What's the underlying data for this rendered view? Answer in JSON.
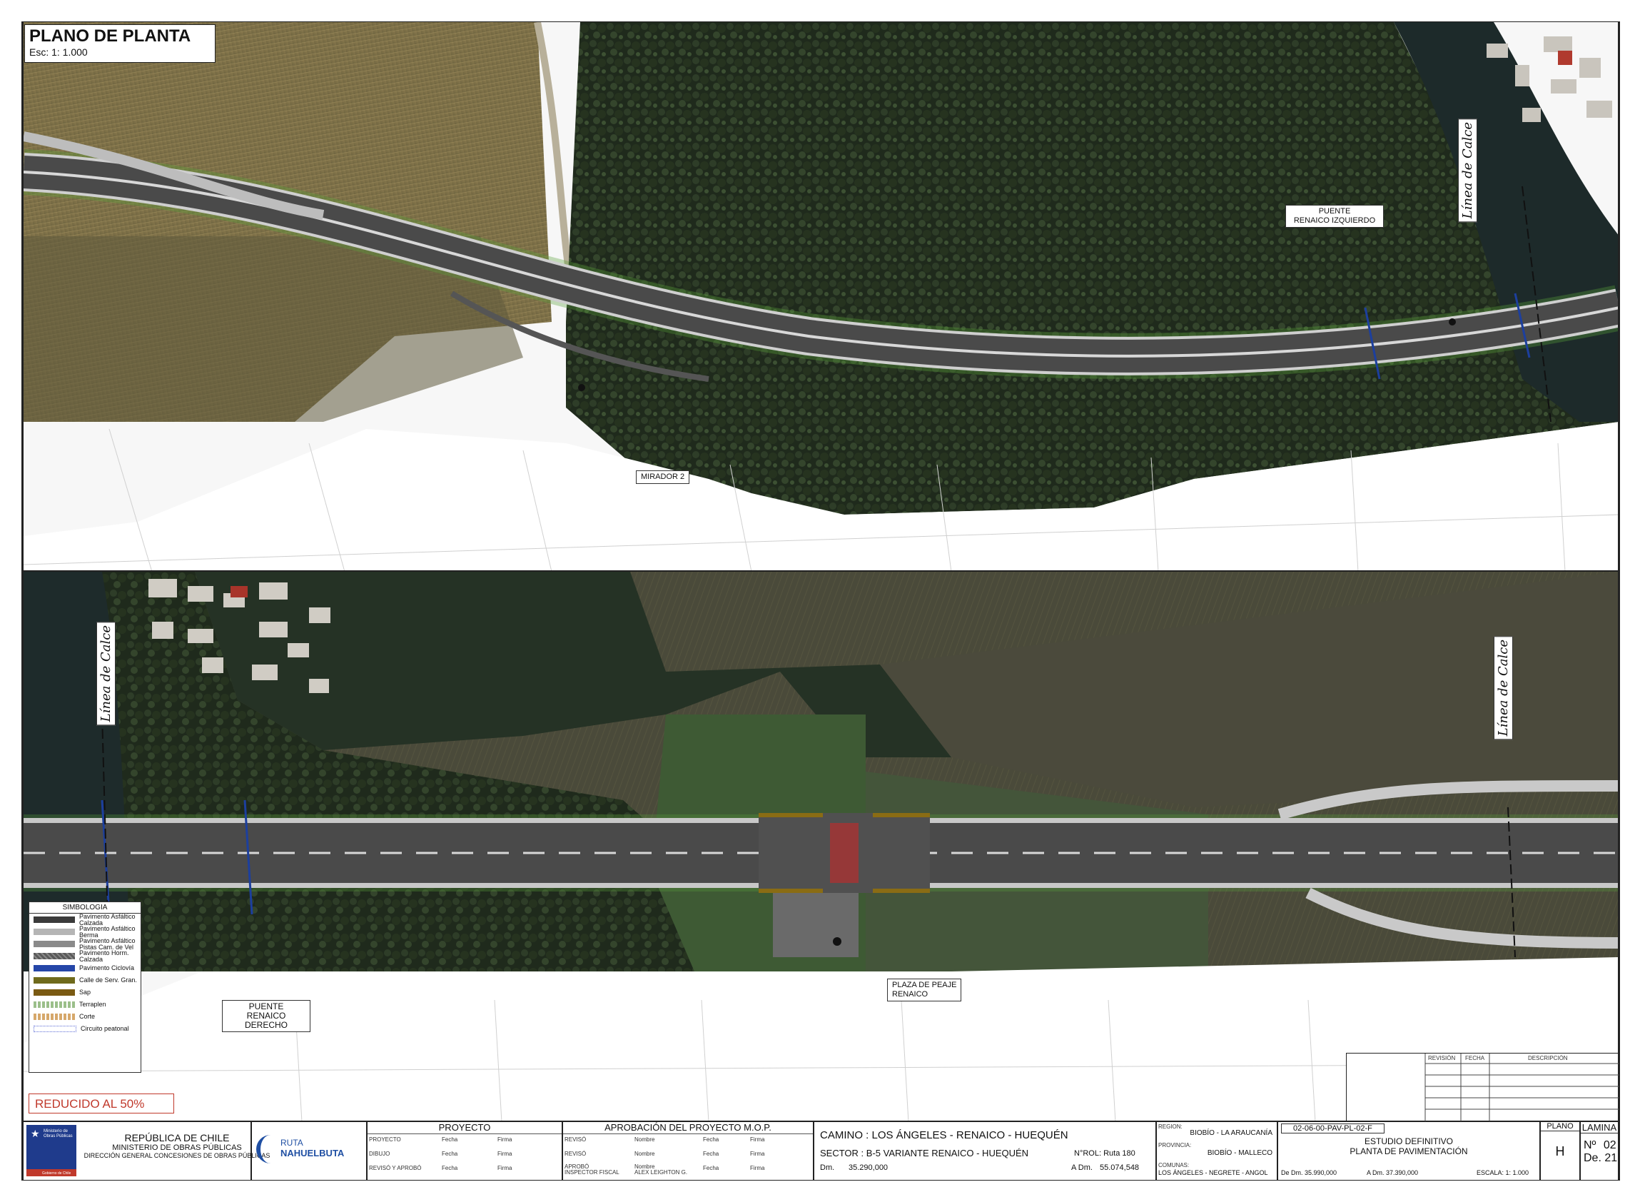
{
  "title": {
    "heading": "PLANO DE PLANTA",
    "scale": "Esc: 1: 1.000"
  },
  "labels": {
    "puente_izq": [
      "PUENTE",
      "RENAICO IZQUIERDO"
    ],
    "mirador": "MIRADOR 2",
    "puente_der": [
      "PUENTE",
      "RENAICO DERECHO"
    ],
    "plaza_peaje": [
      "PLAZA DE PEAJE",
      "RENAICO"
    ],
    "linea_calce": "Línea de Calce"
  },
  "legend": {
    "title": "SIMBOLOGIA",
    "items": [
      {
        "label": "Pavimento Asfáltico Calzada",
        "color": "#3b3b3b",
        "icon": "swatch-solid"
      },
      {
        "label": "Pavimento Asfáltico Berma",
        "color": "#b5b5b5",
        "icon": "swatch-solid"
      },
      {
        "label": "Pavimento Asfáltico Pistas Cam. de Vel",
        "color": "#8a8a8a",
        "icon": "swatch-solid"
      },
      {
        "label": "Pavimento Horm. Calzada",
        "color": "#5a5a5a",
        "icon": "swatch-hatched"
      },
      {
        "label": "Pavimento Ciclovía",
        "color": "#2546a8",
        "icon": "swatch-solid"
      },
      {
        "label": "Calle de Serv. Gran.",
        "color": "#6f6a1c",
        "icon": "swatch-solid"
      },
      {
        "label": "Sap",
        "color": "#7a5a12",
        "icon": "swatch-solid"
      },
      {
        "label": "Terraplen",
        "color": "#9bbf8a",
        "icon": "swatch-dashed"
      },
      {
        "label": "Corte",
        "color": "#d6a86b",
        "icon": "swatch-dashed"
      },
      {
        "label": "Circuito peatonal",
        "color": "#5b6bd6",
        "icon": "swatch-dotted"
      }
    ]
  },
  "reducido": "REDUCIDO AL 50%",
  "revision_table": {
    "headers": [
      "REVISIÓN",
      "FECHA",
      "DESCRIPCIÓN"
    ]
  },
  "titleblock": {
    "gov": [
      "REPÚBLICA DE CHILE",
      "MINISTERIO DE OBRAS PÚBLICAS",
      "DIRECCIÓN GENERAL CONCESIONES DE OBRAS PÚBLICAS"
    ],
    "ministry_logo_text": [
      "Ministerio de",
      "Obras Públicas"
    ],
    "gobierno": "Gobierno de Chile",
    "ruta_logo": [
      "RUTA",
      "NAHUELBUTA"
    ],
    "proyecto_title": "PROYECTO",
    "proyecto_rows": [
      "PROYECTO",
      "DIBUJO",
      "REVISÓ Y APROBÓ"
    ],
    "col_fecha": "Fecha",
    "col_firma": "Firma",
    "aprob_title": "APROBACIÓN DEL PROYECTO M.O.P.",
    "aprob_rows": [
      "REVISÓ",
      "REVISÓ",
      "APROBÓ"
    ],
    "aprob_sub": "INSPECTOR FISCAL",
    "col_nombre": "Nombre",
    "aprob_name": "ALEX LEIGHTON G.",
    "camino": "CAMINO : LOS ÁNGELES - RENAICO - HUEQUÉN",
    "sector": "SECTOR : B-5 VARIANTE RENAICO - HUEQUÉN",
    "rol": "N°ROL: Ruta 180",
    "dm_label": "Dm.",
    "dm_value": "35.290,000",
    "adm_label": "A Dm.",
    "adm_value": "55.074,548",
    "region_label": "REGION:",
    "region": "BIOBÍO - LA ARAUCANÍA",
    "provincia_label": "PROVINCIA:",
    "provincia": "BIOBÍO - MALLECO",
    "comunas_label": "COMUNAS:",
    "comunas": "LOS ÁNGELES - NEGRETE - ANGOL",
    "code": "02-06-00-PAV-PL-02-F",
    "estudio": [
      "ESTUDIO DEFINITIVO",
      "PLANTA DE PAVIMENTACIÓN"
    ],
    "de_dm": "De Dm. 35.990,000",
    "a_dm": "A Dm. 37.390,000",
    "escala": "ESCALA: 1: 1.000",
    "plano_label": "PLANO",
    "plano_value": "H",
    "lamina_label": "LAMINA",
    "lamina_no_label": "Nº",
    "lamina_no": "02",
    "lamina_de": "De. 21"
  }
}
